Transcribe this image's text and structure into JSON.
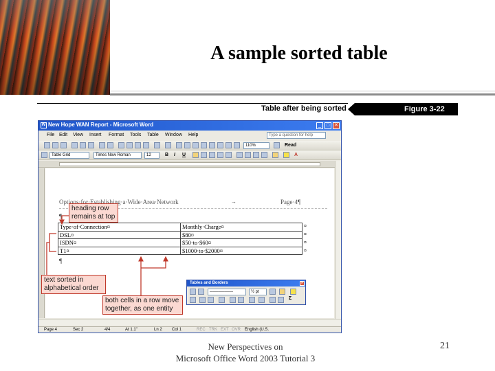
{
  "slide": {
    "title": "A sample sorted table",
    "footer_line1": "New Perspectives on",
    "footer_line2": "Microsoft Office Word 2003 Tutorial 3",
    "page_number": "21"
  },
  "figure": {
    "caption": "Table after being sorted",
    "number": "Figure 3-22"
  },
  "word": {
    "title": "New Hope WAN Report - Microsoft Word",
    "menus": [
      "File",
      "Edit",
      "View",
      "Insert",
      "Format",
      "Tools",
      "Table",
      "Window",
      "Help"
    ],
    "help_placeholder": "Type a question for help",
    "zoom": "110%",
    "read_label": "Read",
    "style": "Table Grid",
    "font": "Times New Roman",
    "font_size": "12",
    "doc_header_left": "Options·for·Establishing·a·Wide·Area·Network",
    "doc_header_arrow": "→",
    "doc_header_right": "Page·4¶",
    "pilcrow_top": "¶",
    "pilcrow_bottom": "¶",
    "cell_mark": "¤",
    "table": {
      "header": [
        "Type·of·Connection¤",
        "Monthly·Charge¤"
      ],
      "rows": [
        [
          "DSL¤",
          "$80¤"
        ],
        [
          "ISDN¤",
          "$50·to·$60¤"
        ],
        [
          "T1¤",
          "$1000·to·$2000¤"
        ]
      ]
    },
    "status": {
      "page": "Page  4",
      "sec": "Sec  2",
      "of": "4/4",
      "at": "At  1.1\"",
      "ln": "Ln  2",
      "col": "Col  1",
      "rec": "REC",
      "trk": "TRK",
      "ext": "EXT",
      "ovr": "OVR",
      "lang": "English (U.S."
    }
  },
  "tables_toolbar": {
    "title": "Tables and Borders",
    "line_weight": "½ pt"
  },
  "callouts": {
    "heading_row": "heading row remains at top",
    "sorted": "text sorted in alphabetical order",
    "cells_move": "both cells in a row move together, as one entity"
  },
  "colors": {
    "callout_border": "#c0392b",
    "callout_fill": "#fbd9d2",
    "xp_title": "#1f55c9"
  }
}
